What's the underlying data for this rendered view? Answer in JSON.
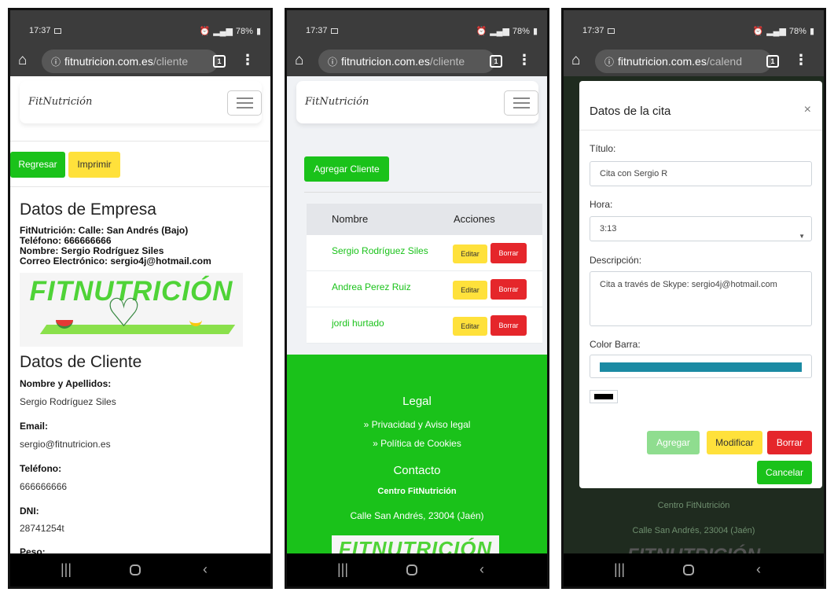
{
  "status": {
    "time": "17:37",
    "battery": "78%"
  },
  "phone1": {
    "url_domain": "fitnutricion.com.es",
    "url_path": "/cliente",
    "brand": "FitNutrición",
    "btn_back": "Regresar",
    "btn_print": "Imprimir",
    "empresa_title": "Datos de Empresa",
    "empresa_lines": [
      "FitNutrición: Calle: San Andrés (Bajo)",
      "Teléfono: 666666666",
      "Nombre: Sergio Rodríguez Siles",
      "Correo Electrónico: sergio4j@hotmail.com"
    ],
    "logo_text": "FITNUTRICIÓN",
    "cliente_title": "Datos de Cliente",
    "fields": [
      {
        "label": "Nombre y Apellidos:",
        "value": "Sergio Rodríguez Siles"
      },
      {
        "label": "Email:",
        "value": "sergio@fitnutricion.es"
      },
      {
        "label": "Teléfono:",
        "value": "666666666"
      },
      {
        "label": "DNI:",
        "value": "28741254t"
      },
      {
        "label": "Peso:",
        "value": ""
      }
    ]
  },
  "phone2": {
    "url_domain": "fitnutricion.com.es",
    "url_path": "/cliente",
    "brand": "FitNutrición",
    "add_button": "Agregar Cliente",
    "col_name": "Nombre",
    "col_actions": "Acciones",
    "rows": [
      {
        "name": "Sergio Rodríguez Siles",
        "edit": "Editar",
        "delete": "Borrar"
      },
      {
        "name": "Andrea Perez Ruiz",
        "edit": "Editar",
        "delete": "Borrar"
      },
      {
        "name": "jordi hurtado",
        "edit": "Editar",
        "delete": "Borrar"
      }
    ],
    "footer": {
      "legal_title": "Legal",
      "link_privacy": "» Privacidad y Aviso legal",
      "link_cookies": "» Política de Cookies",
      "contact_title": "Contacto",
      "center": "Centro FitNutrición",
      "address": "Calle San Andrés, 23004 (Jaén)",
      "logo_text": "FITNUTRICIÓN"
    }
  },
  "phone3": {
    "url_domain": "fitnutricion.com.es",
    "url_path": "/calend",
    "modal_title": "Datos de la cita",
    "close": "×",
    "title_label": "Título:",
    "title_value": "Cita con Sergio R",
    "hour_label": "Hora:",
    "hour_value": "3:13",
    "desc_label": "Descripción:",
    "desc_value": "Cita a través de Skype: sergio4j@hotmail.com",
    "color_label": "Color Barra:",
    "bar_color": "#1b8aa3",
    "btn_add": "Agregar",
    "btn_modify": "Modificar",
    "btn_delete": "Borrar",
    "btn_cancel": "Cancelar",
    "bg_center": "Centro FitNutrición",
    "bg_address": "Calle San Andrés, 23004 (Jaén)",
    "bg_logo": "FITNUTRICIÓN"
  },
  "colors": {
    "green": "#1ac21a",
    "yellow": "#ffe13b",
    "red": "#e5262b"
  }
}
